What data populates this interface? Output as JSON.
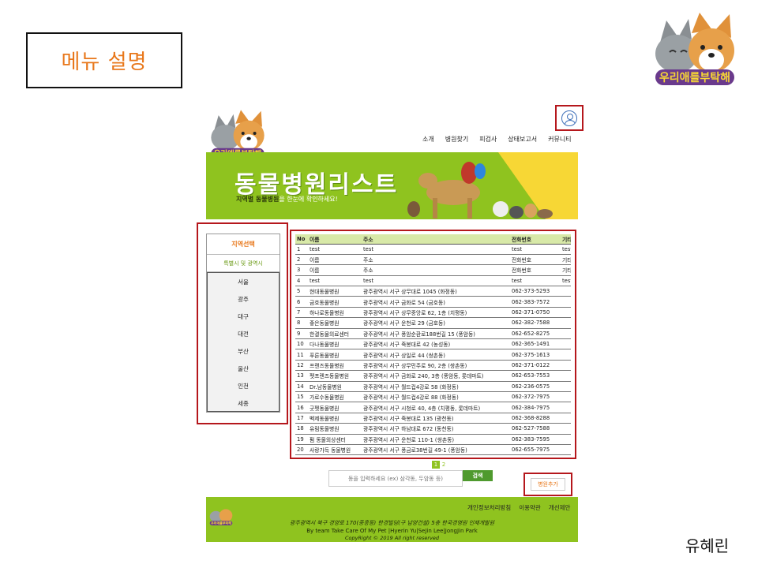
{
  "slide": {
    "title": "메뉴 설명",
    "author": "유혜린"
  },
  "logo": {
    "text": "우리애를부탁해"
  },
  "nav": [
    "소개",
    "병원찾기",
    "피검사",
    "상태보고서",
    "커뮤니티"
  ],
  "banner": {
    "title": "동물병원리스트",
    "subtitle_bold": "지역별 동물병원",
    "subtitle_rest": "을 한눈에 확인하세요!"
  },
  "region": {
    "header": "지역선택",
    "subheader": "특별시 및 광역시",
    "items": [
      "서울",
      "광주",
      "대구",
      "대전",
      "부산",
      "울산",
      "인천",
      "세종"
    ]
  },
  "table": {
    "columns": [
      "No",
      "이름",
      "주소",
      "전화번호",
      "기타"
    ],
    "rows": [
      [
        "1",
        "test",
        "test",
        "test",
        "test"
      ],
      [
        "2",
        "이름",
        "주소",
        "전화번호",
        "기타"
      ],
      [
        "3",
        "이름",
        "주소",
        "전화번호",
        "기타"
      ],
      [
        "4",
        "test",
        "test",
        "test",
        "test"
      ],
      [
        "5",
        "현대동물병원",
        "광주광역시 서구 상무대로 1045 (화정동)",
        "062-373-5293",
        ""
      ],
      [
        "6",
        "금호동물병원",
        "광주광역시 서구 금화로 54 (금호동)",
        "062-383-7572",
        ""
      ],
      [
        "7",
        "하나로동물병원",
        "광주광역시 서구 상무중앙로 62, 1층 (치평동)",
        "062-371-0750",
        ""
      ],
      [
        "8",
        "좋은동물병원",
        "광주광역시 서구 운천로 29 (금호동)",
        "062-382-7588",
        ""
      ],
      [
        "9",
        "한결동물의료센터",
        "광주광역시 서구 풍암순환로188번길 15 (풍암동)",
        "062-652-8275",
        ""
      ],
      [
        "10",
        "다나동물병원",
        "광주광역시 서구 죽봉대로 42 (농성동)",
        "062-365-1491",
        ""
      ],
      [
        "11",
        "푸른동물병원",
        "광주광역시 서구 상일로 44 (쌍촌동)",
        "062-375-1613",
        ""
      ],
      [
        "12",
        "프랜즈동물병원",
        "광주광역시 서구 상무민주로 90, 2층 (쌍촌동)",
        "062-371-0122",
        ""
      ],
      [
        "13",
        "펫프렌즈동물병원",
        "광주광역시 서구 금화로 240, 3층 (풍암동, 롯데마트)",
        "062-653-7553",
        ""
      ],
      [
        "14",
        "Dr.남동물병원",
        "광주광역시 서구 월드컵4강로 58 (화정동)",
        "062-236-0575",
        ""
      ],
      [
        "15",
        "가로수동물병원",
        "광주광역시 서구 월드컵4강로 88 (화정동)",
        "062-372-7975",
        ""
      ],
      [
        "16",
        "굿펫동물병원",
        "광주광역시 서구 시청로 40, 4층 (치평동, 롯데마트)",
        "062-384-7975",
        ""
      ],
      [
        "17",
        "벡제동물병원",
        "광주광역시 서구 죽봉대로 135 (광천동)",
        "062-368-8288",
        ""
      ],
      [
        "18",
        "유림동물병원",
        "광주광역시 서구 하남대로 672 (동천동)",
        "062-527-7588",
        ""
      ],
      [
        "19",
        "펌 동물외상센터",
        "광주광역시 서구 운천로 110-1 (쌍촌동)",
        "062-383-7595",
        ""
      ],
      [
        "20",
        "사랑가득 동물병원",
        "광주광역시 서구 풍금로38번길 49-1 (풍암동)",
        "062-655-7975",
        ""
      ]
    ]
  },
  "pagination": [
    "1",
    "2"
  ],
  "search": {
    "placeholder": "동을 입력하세요 (ex) 삼각동, 두암동 등)",
    "button": "검색"
  },
  "add_button": "병원추가",
  "footer": {
    "links": [
      "개인정보처리방침",
      "이용약관",
      "개선제안"
    ],
    "address": "광주광역시 북구 경양로 170(중흥동) 한경빌딩(구 남양건설) 5층 한국경영원 인재개발원",
    "team": "By team Take Care Of My Pet |Hyerin Yu|SeJin Lee|JongJin Park",
    "copyright": "CopyRight © 2019 All right reserved"
  },
  "colors": {
    "accent_orange": "#e8771a",
    "brand_green": "#8fc31f",
    "highlight_red": "#b5171c"
  }
}
